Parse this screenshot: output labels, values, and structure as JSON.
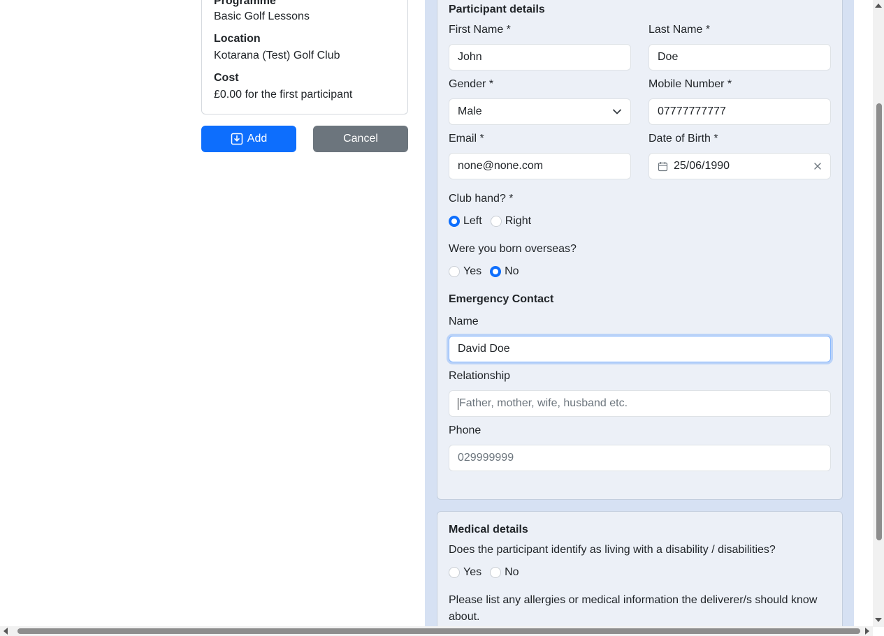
{
  "summary": {
    "programme_label": "Programme",
    "programme_value": "Basic Golf Lessons",
    "location_label": "Location",
    "location_value": "Kotarana (Test) Golf Club",
    "cost_label": "Cost",
    "cost_value": "£0.00 for the first participant"
  },
  "actions": {
    "add_label": "Add",
    "cancel_label": "Cancel"
  },
  "participant": {
    "title": "Participant details",
    "first_name_label": "First Name *",
    "first_name_value": "John",
    "last_name_label": "Last Name *",
    "last_name_value": "Doe",
    "gender_label": "Gender *",
    "gender_value": "Male",
    "mobile_label": "Mobile Number *",
    "mobile_value": "07777777777",
    "email_label": "Email *",
    "email_value": "none@none.com",
    "dob_label": "Date of Birth *",
    "dob_value": "25/06/1990",
    "club_hand_label": "Club hand? *",
    "club_hand_options": [
      "Left",
      "Right"
    ],
    "club_hand_selected": "Left",
    "overseas_label": "Were you born overseas?",
    "overseas_options": [
      "Yes",
      "No"
    ],
    "overseas_selected": "No"
  },
  "emergency": {
    "title": "Emergency Contact",
    "name_label": "Name",
    "name_value": "David Doe",
    "relationship_label": "Relationship",
    "relationship_placeholder": "Father, mother, wife, husband etc.",
    "phone_label": "Phone",
    "phone_placeholder": "029999999"
  },
  "medical": {
    "title": "Medical details",
    "disability_question": "Does the participant identify as living with a disability / disabilities?",
    "disability_options": [
      "Yes",
      "No"
    ],
    "allergies_text_line1": "Please list any allergies or medical information the deliverer/s should know",
    "allergies_text_line2": "about."
  },
  "colors": {
    "primary": "#0d6efd",
    "secondary": "#6c757d",
    "panel_bg": "#ecf0f7",
    "column_bg": "#d6e1f3"
  }
}
